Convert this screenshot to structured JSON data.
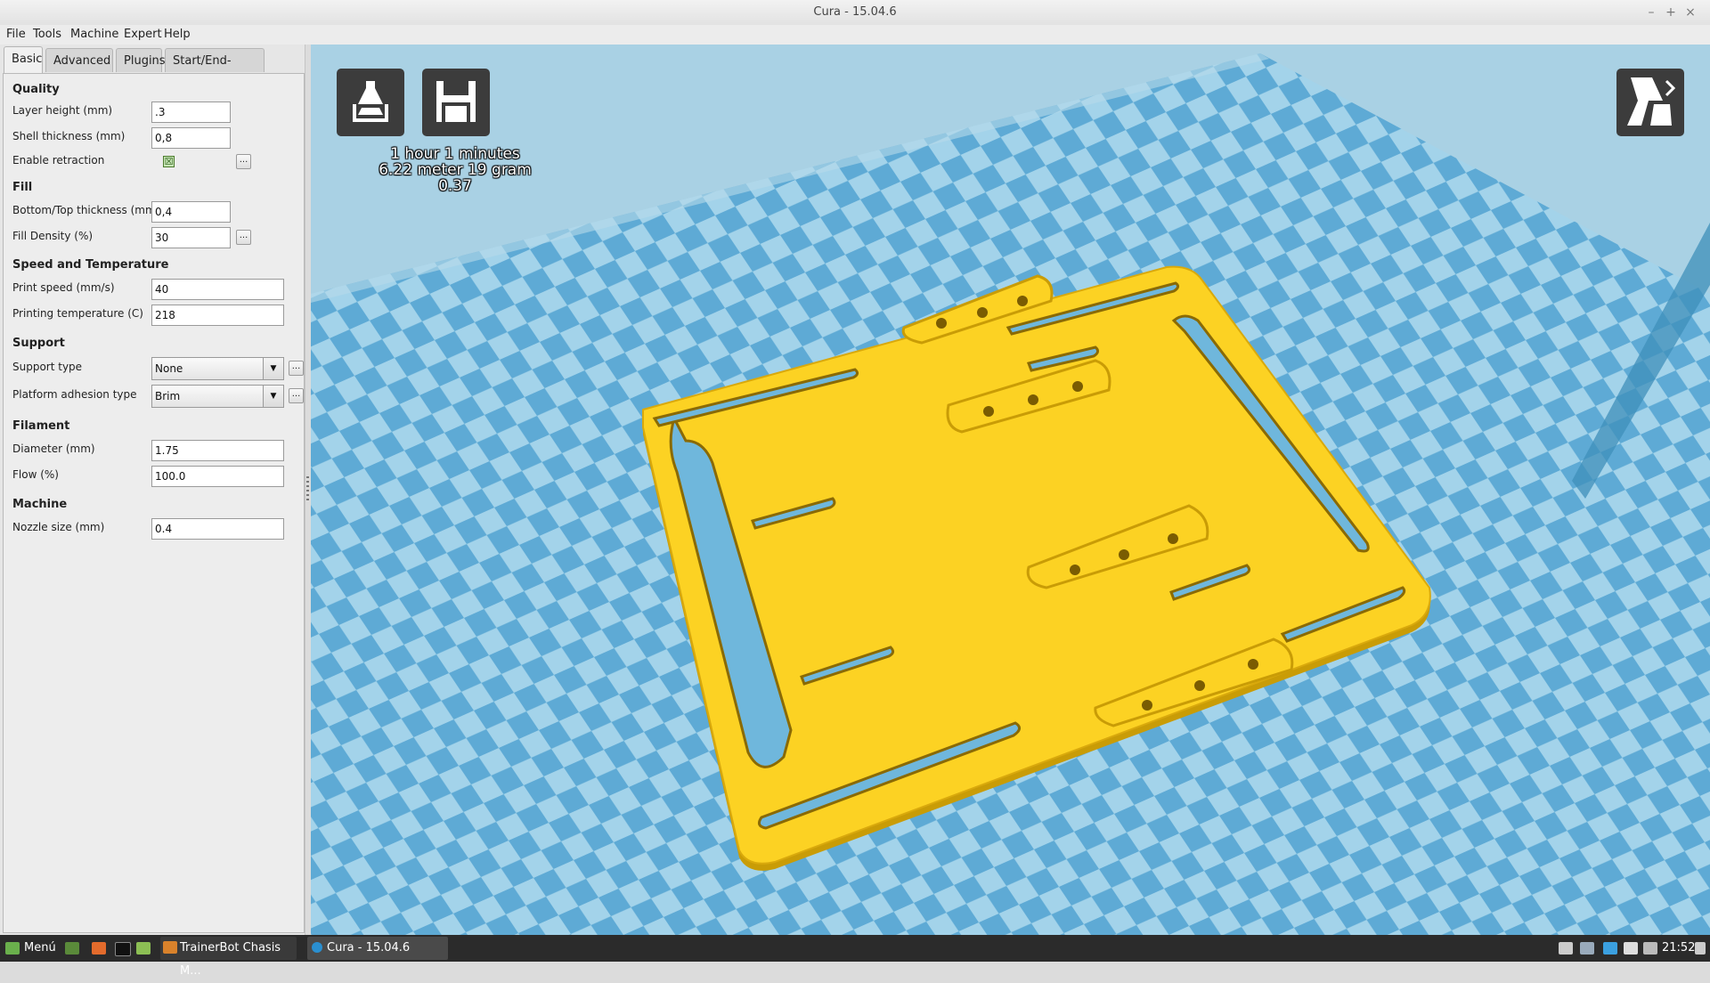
{
  "window": {
    "title": "Cura - 15.04.6",
    "controls": [
      "–",
      "+",
      "×"
    ]
  },
  "menu": [
    "File",
    "Tools",
    "Machine",
    "Expert",
    "Help"
  ],
  "tabs": [
    "Basic",
    "Advanced",
    "Plugins",
    "Start/End-GCode"
  ],
  "settings": {
    "quality": {
      "header": "Quality",
      "layer_height_label": "Layer height (mm)",
      "layer_height": ".3",
      "shell_thickness_label": "Shell thickness (mm)",
      "shell_thickness": "0,8",
      "retraction_label": "Enable retraction",
      "retraction_checked": "☒"
    },
    "fill": {
      "header": "Fill",
      "bottom_top_label": "Bottom/Top thickness (mm)",
      "bottom_top": "0,4",
      "density_label": "Fill Density (%)",
      "density": "30"
    },
    "speed": {
      "header": "Speed and Temperature",
      "print_speed_label": "Print speed (mm/s)",
      "print_speed": "40",
      "temp_label": "Printing temperature (C)",
      "temp": "218"
    },
    "support": {
      "header": "Support",
      "type_label": "Support type",
      "type": "None",
      "adhesion_label": "Platform adhesion type",
      "adhesion": "Brim"
    },
    "filament": {
      "header": "Filament",
      "diameter_label": "Diameter (mm)",
      "diameter": "1.75",
      "flow_label": "Flow (%)",
      "flow": "100.0"
    },
    "machine": {
      "header": "Machine",
      "nozzle_label": "Nozzle size (mm)",
      "nozzle": "0.4"
    },
    "dots": "..."
  },
  "viewport": {
    "print_time": "1 hour 1 minutes",
    "material": "6.22 meter 19 gram",
    "cost": "0.37",
    "load_icon": "load-model-icon",
    "save_icon": "save-icon",
    "view_mode_icon": "view-mode-icon",
    "colors": {
      "model": "#fcd223",
      "model_side": "#c99c06",
      "bed_light": "#9ed1ea",
      "bed_dark": "#5aa9d6"
    }
  },
  "taskbar": {
    "menu_label": "Menú",
    "tasks": [
      "TrainerBot Chasis M...",
      "Cura - 15.04.6"
    ],
    "clock": "21:52"
  }
}
